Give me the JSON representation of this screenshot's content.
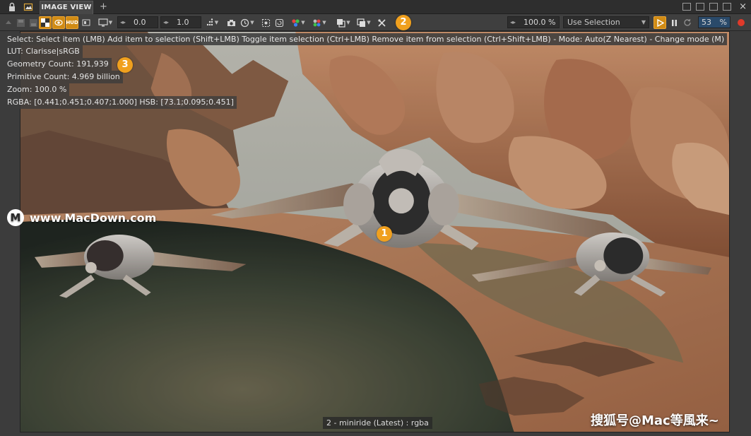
{
  "tabbar": {
    "tab_label": "IMAGE VIEW",
    "add_tab": "+",
    "close": "×"
  },
  "toolbar": {
    "exposure_value": "0.0",
    "gamma_value": "1.0",
    "zoom_value": "100.0 %",
    "selection_mode": "Use Selection",
    "progress_value": "53",
    "progress_unit": "%"
  },
  "viewport": {
    "help_text": "Select: Select item (LMB)  Add item to selection (Shift+LMB)  Toggle item selection (Ctrl+LMB)  Remove item from selection (Ctrl+Shift+LMB)  - Mode: Auto(Z Nearest) - Change mode (M)",
    "info": {
      "lut": "LUT: Clarisse|sRGB",
      "geometry": "Geometry Count: 191,939",
      "primitive": "Primitive Count: 4.969 billion",
      "zoom": "Zoom: 100.0 %",
      "pixel": "RGBA: [0.441;0.451;0.407;1.000] HSB: [73.1;0.095;0.451]"
    },
    "caption": "2 - miniride (Latest) : rgba"
  },
  "annotations": {
    "badge_1": "1",
    "badge_2": "2",
    "badge_3": "3"
  },
  "watermarks": {
    "site_logo": "M",
    "site": "www.MacDown.com",
    "source": "搜狐号@Mac等風来~"
  },
  "colors": {
    "accent": "#f0a01e",
    "active_button": "#d08b14",
    "record": "#e03a2a",
    "panel_bg": "#3c3c3c"
  }
}
